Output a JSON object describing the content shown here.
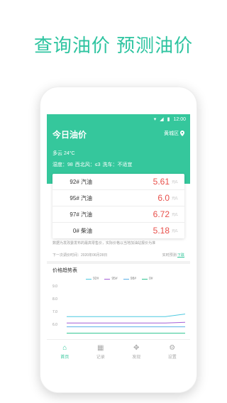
{
  "headline": "查询油价  预测油价",
  "status": {
    "time": "12:00"
  },
  "header": {
    "title": "今日油价",
    "region": "黄城区",
    "weather": "多云  24°C",
    "humidity": "湿度：98",
    "wind": "西北风：≤3",
    "carwash": "洗车：不适宜"
  },
  "prices": [
    {
      "name": "92# 汽油",
      "price": "5.61",
      "unit": "元/L"
    },
    {
      "name": "95# 汽油",
      "price": "6.0",
      "unit": "元/L"
    },
    {
      "name": "97# 汽油",
      "price": "6.72",
      "unit": "元/L"
    },
    {
      "name": "0# 柴油",
      "price": "5.18",
      "unit": "元/L"
    }
  ],
  "notes": {
    "line1": "数据为发改委发布的最高零售价，实际价格以当地加油站报价为准",
    "next_adjust": "下一次调价时间：2020年06月28日",
    "realtime": "实时预测:",
    "link": "下跌"
  },
  "trend": {
    "title": "价格趋势表",
    "legend": [
      "92#",
      "95#",
      "98#",
      "0#"
    ]
  },
  "chart_data": {
    "type": "line",
    "yticks": [
      "9.0",
      "8.0",
      "7.0",
      "6.0",
      "5.0"
    ],
    "ylim": [
      5.0,
      9.0
    ],
    "series": [
      {
        "name": "92#",
        "color": "#4cc9e0",
        "values": [
          6.6,
          6.6,
          6.6,
          6.6,
          6.6,
          6.6,
          6.8
        ]
      },
      {
        "name": "95#",
        "color": "#a45ed6",
        "values": [
          6.1,
          6.1,
          6.1,
          6.1,
          6.1,
          6.1,
          6.15
        ]
      },
      {
        "name": "98#",
        "color": "#5ab0e8",
        "values": [
          5.8,
          5.8,
          5.8,
          5.8,
          5.8,
          5.8,
          5.8
        ]
      },
      {
        "name": "0#",
        "color": "#2ec48f",
        "values": [
          5.3,
          5.3,
          5.3,
          5.3,
          5.3,
          5.3,
          5.3
        ]
      }
    ]
  },
  "tabs": [
    {
      "label": "首页",
      "icon": "home-icon",
      "active": true
    },
    {
      "label": "记录",
      "icon": "calendar-icon",
      "active": false
    },
    {
      "label": "发现",
      "icon": "gamepad-icon",
      "active": false
    },
    {
      "label": "设置",
      "icon": "gear-icon",
      "active": false
    }
  ]
}
